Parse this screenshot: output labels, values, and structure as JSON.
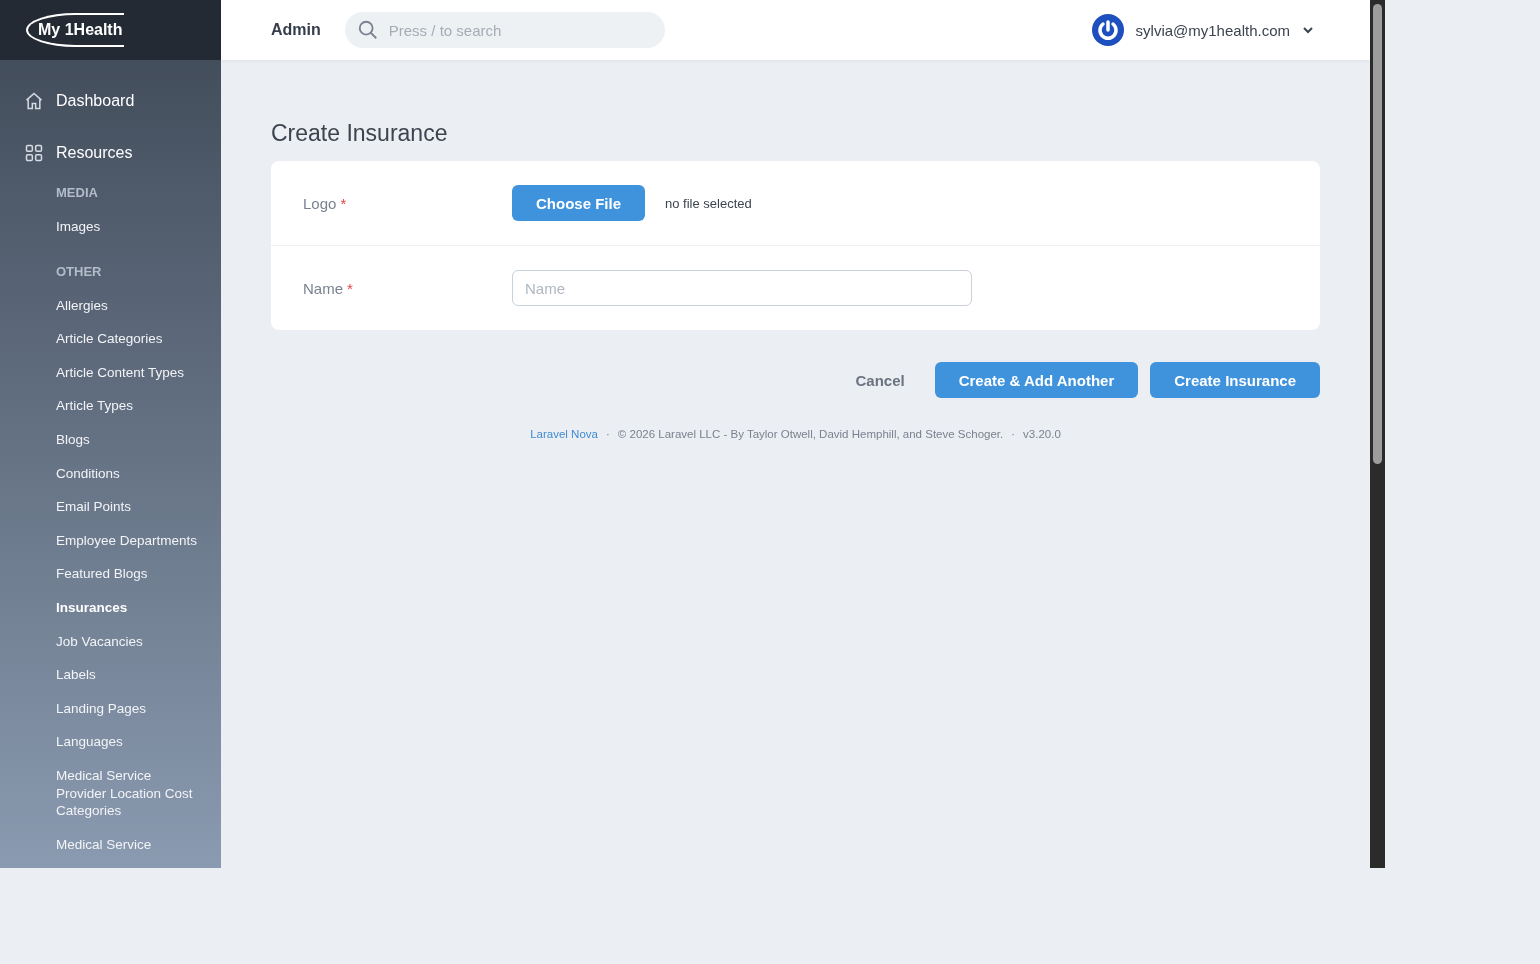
{
  "brand": {
    "logo": "My 1Health"
  },
  "nav": [
    {
      "label": "Dashboard"
    },
    {
      "label": "Resources"
    }
  ],
  "sections": [
    {
      "heading": "MEDIA",
      "items": [
        {
          "label": "Images",
          "selected": false
        }
      ]
    },
    {
      "heading": "OTHER",
      "items": [
        {
          "label": "Allergies",
          "selected": false
        },
        {
          "label": "Article Categories",
          "selected": false
        },
        {
          "label": "Article Content Types",
          "selected": false
        },
        {
          "label": "Article Types",
          "selected": false
        },
        {
          "label": "Blogs",
          "selected": false
        },
        {
          "label": "Conditions",
          "selected": false
        },
        {
          "label": "Email Points",
          "selected": false
        },
        {
          "label": "Employee Departments",
          "selected": false
        },
        {
          "label": "Featured Blogs",
          "selected": false
        },
        {
          "label": "Insurances",
          "selected": true
        },
        {
          "label": "Job Vacancies",
          "selected": false
        },
        {
          "label": "Labels",
          "selected": false
        },
        {
          "label": "Landing Pages",
          "selected": false
        },
        {
          "label": "Languages",
          "selected": false
        },
        {
          "label": "Medical Service Provider Location Cost Categories",
          "selected": false
        },
        {
          "label": "Medical Service",
          "selected": false
        }
      ]
    }
  ],
  "header": {
    "title": "Admin",
    "search": {
      "placeholder": "Press / to search"
    },
    "user": "sylvia@my1health.com"
  },
  "page": {
    "title": "Create Insurance",
    "fields": [
      {
        "kind": "file",
        "label": "Logo",
        "required_mark": "*",
        "button": "Choose File",
        "status": "no file selected"
      },
      {
        "kind": "text",
        "label": "Name",
        "required_mark": "*",
        "placeholder": "Name"
      }
    ],
    "actions": [
      {
        "kind": "link",
        "label": "Cancel"
      },
      {
        "kind": "primary",
        "label": "Create & Add Another"
      },
      {
        "kind": "primary",
        "label": "Create Insurance"
      }
    ]
  },
  "footer": {
    "link": "Laravel Nova",
    "sep1": "·",
    "copyright": "© 2026 Laravel LLC - By Taylor Otwell, David Hemphill, and Steve Schoger.",
    "sep2": "·",
    "version": "v3.20.0"
  }
}
